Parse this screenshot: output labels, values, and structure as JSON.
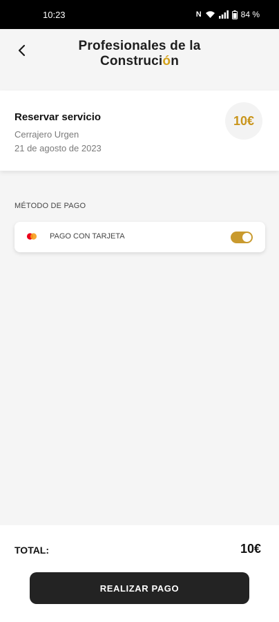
{
  "status_bar": {
    "time": "10:23",
    "battery": "84 %"
  },
  "header": {
    "title_line1": "Profesionales de la",
    "title_line2_part1": "Construci",
    "title_line2_accent": "ó",
    "title_line2_part2": "n"
  },
  "service": {
    "title": "Reservar servicio",
    "name": "Cerrajero Urgen",
    "date": "21 de agosto de 2023",
    "price": "10€"
  },
  "payment": {
    "section_label": "MÉTODO DE PAGO",
    "method_label": "PAGO CON TARJETA",
    "method_icon": "mastercard-icon",
    "enabled": true
  },
  "footer": {
    "total_label": "TOTAL:",
    "total_value": "10€",
    "pay_button_label": "REALIZAR PAGO"
  },
  "colors": {
    "accent": "#d4a21c",
    "button": "#232323"
  }
}
